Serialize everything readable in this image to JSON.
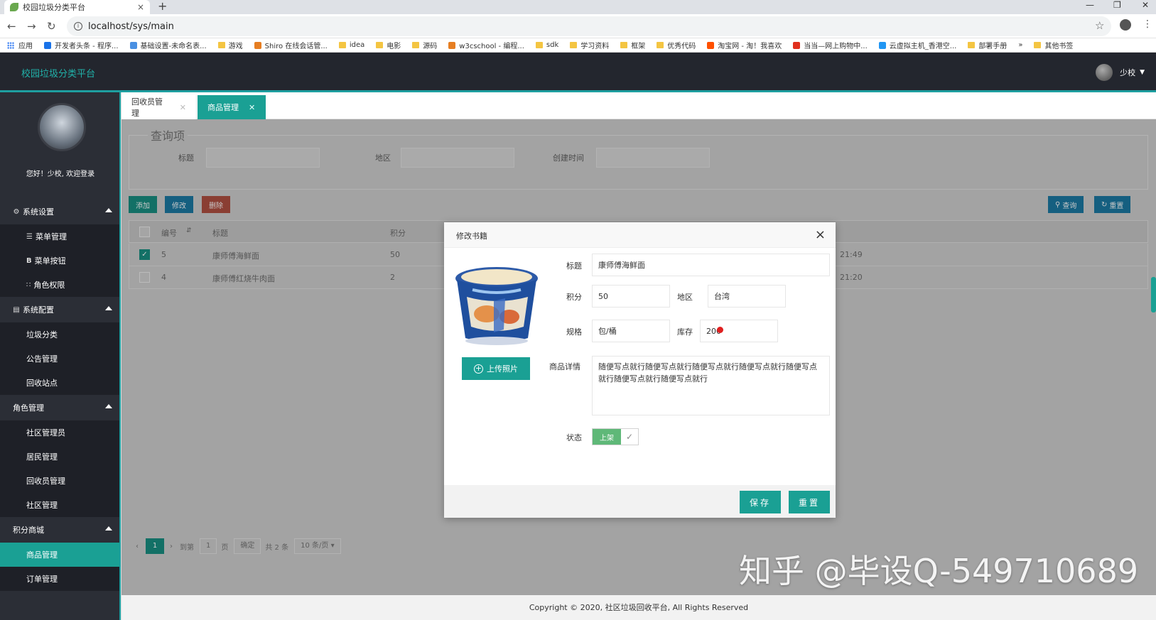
{
  "browser": {
    "tab_title": "校园垃圾分类平台",
    "tab_close": "×",
    "new_tab": "+",
    "url": "localhost/sys/main",
    "bookmarks": [
      "应用",
      "开发者头条 - 程序...",
      "基础设置-未命名表...",
      "游戏",
      "Shiro 在线会话管...",
      "idea",
      "电影",
      "源码",
      "w3cschool - 编程...",
      "sdk",
      "学习资料",
      "框架",
      "优秀代码",
      "淘宝网 - 淘！我喜欢",
      "当当—网上购物中...",
      "云虚拟主机_香港空...",
      "部署手册",
      "»",
      "其他书签"
    ]
  },
  "header": {
    "brand": "校园垃圾分类平台",
    "username": "少校"
  },
  "sidebar": {
    "welcome": "您好！少校, 欢迎登录",
    "groups": [
      {
        "label": "系统设置",
        "items": [
          "菜单管理",
          "菜单按钮",
          "角色权限"
        ]
      },
      {
        "label": "系统配置",
        "items": [
          "垃圾分类",
          "公告管理",
          "回收站点"
        ]
      },
      {
        "label": "角色管理",
        "items": [
          "社区管理员",
          "居民管理",
          "回收员管理",
          "社区管理"
        ]
      },
      {
        "label": "积分商城",
        "items": [
          "商品管理",
          "订单管理"
        ]
      }
    ]
  },
  "tabs": [
    {
      "label": "回收员管理"
    },
    {
      "label": "商品管理"
    }
  ],
  "query": {
    "legend": "查询项",
    "title_label": "标题",
    "region_label": "地区",
    "created_label": "创建时间"
  },
  "toolbar": {
    "add": "添加",
    "edit": "修改",
    "delete": "删除",
    "search": "查询",
    "reset": "重置"
  },
  "table": {
    "headers": {
      "id": "编号",
      "title": "标题",
      "points": "积分"
    },
    "rows": [
      {
        "id": "5",
        "title": "康师傅海鲜面",
        "points": "50",
        "time": "21:49",
        "checked": true
      },
      {
        "id": "4",
        "title": "康师傅红烧牛肉面",
        "points": "2",
        "time": "21:20",
        "checked": false
      }
    ]
  },
  "pager": {
    "current": "1",
    "goto_label": "到第",
    "page_input": "1",
    "page_unit": "页",
    "confirm": "确定",
    "total": "共 2 条",
    "page_size": "10 条/页"
  },
  "modal": {
    "title": "修改书籍",
    "upload": "上传照片",
    "fields": {
      "title_label": "标题",
      "title_value": "康师傅海鲜面",
      "points_label": "积分",
      "points_value": "50",
      "region_label": "地区",
      "region_value": "台湾",
      "spec_label": "规格",
      "spec_value": "包/桶",
      "stock_label": "库存",
      "stock_value": "200",
      "detail_label": "商品详情",
      "detail_value": "随便写点就行随便写点就行随便写点就行随便写点就行随便写点就行随便写点就行随便写点就行",
      "status_label": "状态",
      "status_value": "上架"
    },
    "save": "保存",
    "reset": "重置"
  },
  "footer": "Copyright © 2020, 社区垃圾回收平台, All Rights Reserved",
  "watermark": "知乎 @毕设Q-549710689",
  "colors": {
    "accent": "#1aa094",
    "header_bg": "#23262e",
    "sidebar_bg": "#2b2e36",
    "switch_on": "#5fb878"
  }
}
